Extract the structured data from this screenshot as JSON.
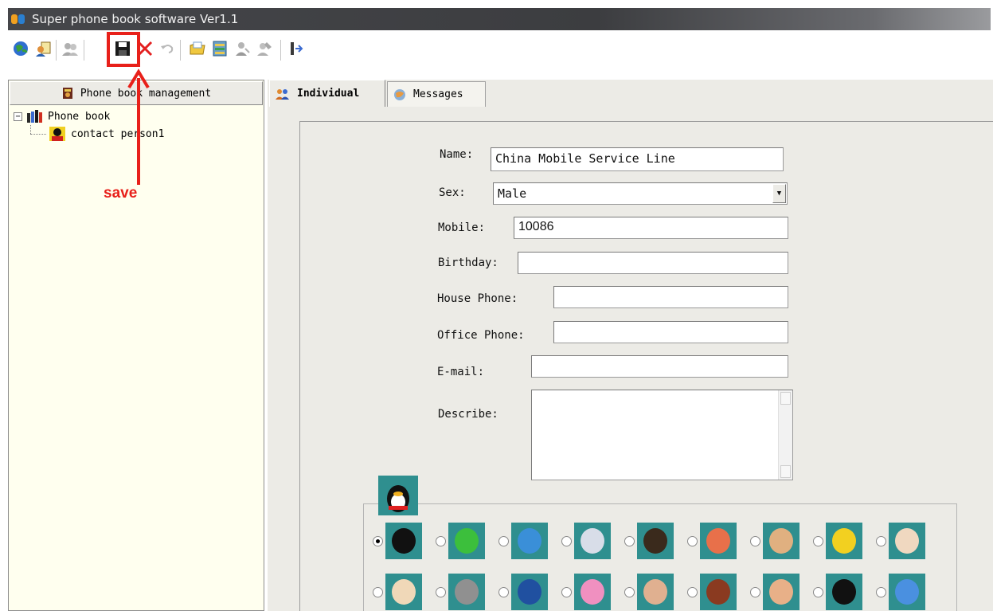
{
  "window": {
    "title": "Super phone book software Ver1.1"
  },
  "toolbar": {
    "buttons": [
      {
        "name": "globe-icon"
      },
      {
        "name": "contacts-icon"
      },
      {
        "name": "users-icon"
      },
      {
        "name": "save-icon"
      },
      {
        "name": "delete-icon"
      },
      {
        "name": "undo-icon"
      },
      {
        "name": "folder-icon"
      },
      {
        "name": "list-icon"
      },
      {
        "name": "person-icon"
      },
      {
        "name": "edit-icon"
      },
      {
        "name": "exit-icon"
      }
    ]
  },
  "annotation": {
    "label": "save",
    "color": "#e8201a"
  },
  "sidebar": {
    "header": "Phone book management",
    "tree": {
      "root": "Phone book",
      "children": [
        "contact person1"
      ]
    },
    "background": "#ffffef"
  },
  "tabs": [
    {
      "label": "Individual",
      "active": true
    },
    {
      "label": "Messages",
      "active": false
    }
  ],
  "form": {
    "name": {
      "label": "Name:",
      "value": "China Mobile Service Line"
    },
    "sex": {
      "label": "Sex:",
      "value": "Male"
    },
    "mobile": {
      "label": "Mobile:",
      "value": "10086"
    },
    "birthday": {
      "label": "Birthday:",
      "value": ""
    },
    "house_phone": {
      "label": "House Phone:",
      "value": ""
    },
    "office_phone": {
      "label": "Office Phone:",
      "value": ""
    },
    "email": {
      "label": "E-mail:",
      "value": ""
    },
    "describe": {
      "label": "Describe:",
      "value": ""
    }
  },
  "avatars": {
    "selected_index": 0,
    "row1": [
      {
        "name": "penguin-avatar",
        "color": "#111111"
      },
      {
        "name": "green-dragon-avatar",
        "color": "#3cbf3c"
      },
      {
        "name": "blue-dog-avatar",
        "color": "#3a8fd8"
      },
      {
        "name": "white-rabbit-avatar",
        "color": "#d8dde8"
      },
      {
        "name": "bearded-man-avatar",
        "color": "#3a2a1c"
      },
      {
        "name": "redhead-girl-avatar",
        "color": "#e8704a"
      },
      {
        "name": "boy-avatar",
        "color": "#e0b080"
      },
      {
        "name": "chick-avatar",
        "color": "#f2d020"
      },
      {
        "name": "nurse-avatar",
        "color": "#f0d8c0"
      }
    ],
    "row2": [
      {
        "name": "chef-avatar",
        "color": "#f0d8b8"
      },
      {
        "name": "gray-cat-avatar",
        "color": "#909090"
      },
      {
        "name": "blue-hair-girl-avatar",
        "color": "#2050a0"
      },
      {
        "name": "pink-rabbit-avatar",
        "color": "#f090c0"
      },
      {
        "name": "pirate-avatar",
        "color": "#e0b090"
      },
      {
        "name": "hat-man-avatar",
        "color": "#8a3a20"
      },
      {
        "name": "baby-avatar",
        "color": "#e8b088"
      },
      {
        "name": "penguin-2-avatar",
        "color": "#111111"
      },
      {
        "name": "blue-bunny-avatar",
        "color": "#4a90e0"
      }
    ]
  }
}
